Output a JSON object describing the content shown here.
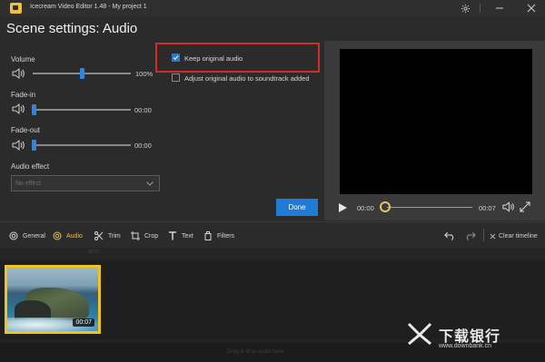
{
  "window": {
    "title": "Icecream Video Editor 1.48  -  My project 1",
    "icons": {
      "settings": "gear-icon",
      "minimize": "minimize-icon",
      "close": "close-icon"
    }
  },
  "header": {
    "title": "Scene settings: Audio"
  },
  "audio": {
    "volume": {
      "label": "Volume",
      "value": "100%",
      "level": 1.0
    },
    "fade_in": {
      "label": "Fade-in",
      "value": "00:00"
    },
    "fade_out": {
      "label": "Fade-out",
      "value": "00:00"
    },
    "effect": {
      "label": "Audio effect",
      "placeholder": "No effect"
    },
    "keep_original": {
      "label": "Keep original audio",
      "checked": true
    },
    "adjust_original": {
      "label": "Adjust original audio to soundtrack added",
      "checked": false
    },
    "done_label": "Done"
  },
  "player": {
    "current_time": "00:00",
    "duration": "00:07"
  },
  "toolbar": {
    "tools": [
      {
        "label": "General",
        "icon": "gear-icon"
      },
      {
        "label": "Audio",
        "icon": "gear-icon",
        "active": true
      },
      {
        "label": "Trim",
        "icon": "scissors-icon"
      },
      {
        "label": "Crop",
        "icon": "crop-icon"
      },
      {
        "label": "Text",
        "icon": "text-icon"
      },
      {
        "label": "Filters",
        "icon": "filters-icon"
      }
    ],
    "clear_label": "Clear timeline"
  },
  "timeline": {
    "ruler_mark": "00:07",
    "clip_duration": "00:07",
    "drop_hint": "Drag & drop audio here"
  },
  "watermark": {
    "brand": "下载银行",
    "url": "www.downbank.cn"
  },
  "colors": {
    "accent": "#1f7bd6",
    "highlight_red": "#d42a2a",
    "active_tool": "#e2c15a",
    "clip_border": "#f0c419"
  }
}
